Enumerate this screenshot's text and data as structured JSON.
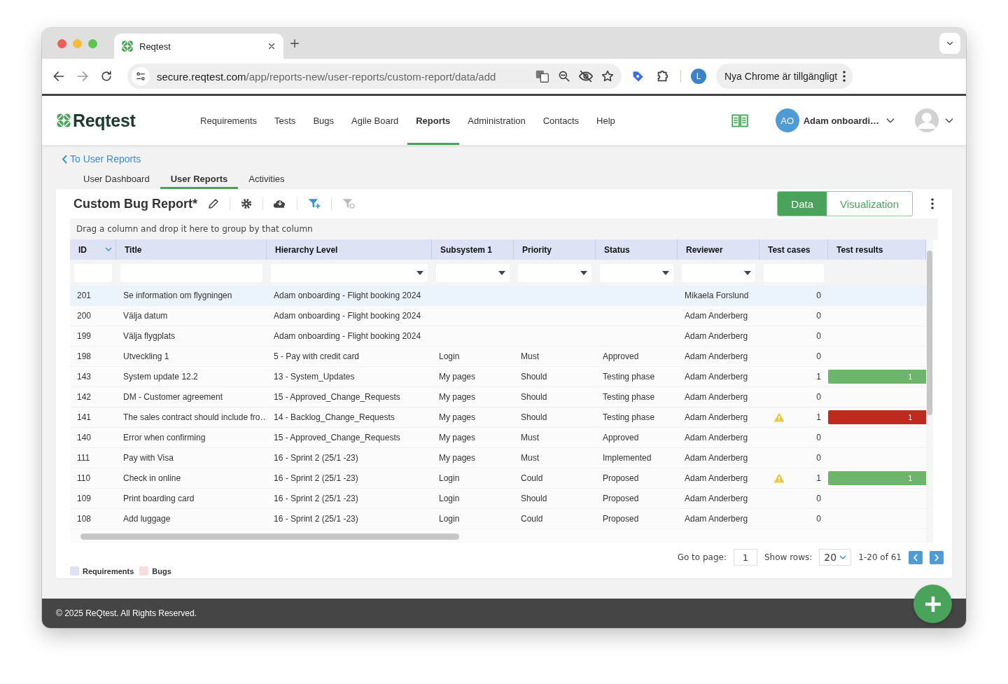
{
  "browser": {
    "tab_title": "Reqtest",
    "url_host": "secure.reqtest.com",
    "url_path": "/app/reports-new/user-reports/custom-report/data/add",
    "profile": "L",
    "update_button": "Nya Chrome är tillgängligt"
  },
  "header": {
    "logo": "Reqtest",
    "nav": [
      {
        "label": "Requirements",
        "selected": false
      },
      {
        "label": "Tests",
        "selected": false
      },
      {
        "label": "Bugs",
        "selected": false
      },
      {
        "label": "Agile Board",
        "selected": false
      },
      {
        "label": "Reports",
        "selected": true
      },
      {
        "label": "Administration",
        "selected": false
      },
      {
        "label": "Contacts",
        "selected": false
      },
      {
        "label": "Help",
        "selected": false
      }
    ],
    "user_initials": "AO",
    "user_name": "Adam onboardi…"
  },
  "back_link": "To User Reports",
  "subtabs": [
    {
      "label": "User Dashboard",
      "selected": false
    },
    {
      "label": "User Reports",
      "selected": true
    },
    {
      "label": "Activities",
      "selected": false
    }
  ],
  "report": {
    "title": "Custom Bug Report*",
    "views": [
      {
        "label": "Data",
        "selected": true
      },
      {
        "label": "Visualization",
        "selected": false
      }
    ],
    "group_hint": "Drag a column and drop it here to group by that column"
  },
  "table": {
    "columns": [
      {
        "label": "ID",
        "kind": "text",
        "sortable": true
      },
      {
        "label": "Title",
        "kind": "text",
        "sortable": false
      },
      {
        "label": "Hierarchy Level",
        "kind": "select",
        "sortable": false
      },
      {
        "label": "Subsystem 1",
        "kind": "select",
        "sortable": false
      },
      {
        "label": "Priority",
        "kind": "select",
        "sortable": false
      },
      {
        "label": "Status",
        "kind": "select",
        "sortable": false
      },
      {
        "label": "Reviewer",
        "kind": "select",
        "sortable": false
      },
      {
        "label": "Test cases",
        "kind": "text",
        "sortable": false
      },
      {
        "label": "Test results",
        "kind": "none",
        "sortable": false
      }
    ],
    "rows": [
      {
        "selected": true,
        "cells": [
          "201",
          "Se information om flygningen",
          "Adam onboarding - Flight booking 2024",
          "",
          "",
          "",
          "Mikaela Forslund",
          "0"
        ],
        "warning": false
      },
      {
        "selected": false,
        "cells": [
          "200",
          "Välja datum",
          "Adam onboarding - Flight booking 2024",
          "",
          "",
          "",
          "Adam Anderberg",
          "0"
        ],
        "warning": false
      },
      {
        "selected": false,
        "cells": [
          "199",
          "Välja flygplats",
          "Adam onboarding - Flight booking 2024",
          "",
          "",
          "",
          "Adam Anderberg",
          "0"
        ],
        "warning": false
      },
      {
        "selected": false,
        "cells": [
          "198",
          "Utveckling 1",
          "5 - Pay with credit card",
          "Login",
          "Must",
          "Approved",
          "Adam Anderberg",
          "0"
        ],
        "warning": false
      },
      {
        "selected": false,
        "cells": [
          "143",
          "System update 12.2",
          "13 - System_Updates",
          "My pages",
          "Should",
          "Testing phase",
          "Adam Anderberg",
          "1"
        ],
        "warning": false,
        "result": {
          "label": "1",
          "color": "#6db56d"
        }
      },
      {
        "selected": false,
        "cells": [
          "142",
          "DM - Customer agreement",
          "15 - Approved_Change_Requests",
          "My pages",
          "Should",
          "Testing phase",
          "Adam Anderberg",
          "0"
        ],
        "warning": false
      },
      {
        "selected": false,
        "cells": [
          "141",
          "The sales contract should include fro…",
          "14 - Backlog_Change_Requests",
          "My pages",
          "Should",
          "Testing phase",
          "Adam Anderberg",
          "1"
        ],
        "warning": true,
        "result": {
          "label": "1",
          "color": "#bf2a1f"
        }
      },
      {
        "selected": false,
        "cells": [
          "140",
          "Error when confirming",
          "15 - Approved_Change_Requests",
          "My pages",
          "Must",
          "Approved",
          "Adam Anderberg",
          "0"
        ],
        "warning": false
      },
      {
        "selected": false,
        "cells": [
          "111",
          "Pay with Visa",
          "16 - Sprint 2 (25/1 -23)",
          "My pages",
          "Must",
          "Implemented",
          "Adam Anderberg",
          "0"
        ],
        "warning": false
      },
      {
        "selected": false,
        "cells": [
          "110",
          "Check in online",
          "16 - Sprint 2 (25/1 -23)",
          "Login",
          "Could",
          "Proposed",
          "Adam Anderberg",
          "1"
        ],
        "warning": true,
        "result": {
          "label": "1",
          "color": "#6db56d"
        }
      },
      {
        "selected": false,
        "cells": [
          "109",
          "Print boarding card",
          "16 - Sprint 2 (25/1 -23)",
          "Login",
          "Should",
          "Proposed",
          "Adam Anderberg",
          "0"
        ],
        "warning": false
      },
      {
        "selected": false,
        "cells": [
          "108",
          "Add luggage",
          "16 - Sprint 2 (25/1 -23)",
          "Login",
          "Could",
          "Proposed",
          "Adam Anderberg",
          "0"
        ],
        "warning": false
      }
    ]
  },
  "pager": {
    "go_to_label": "Go to page:",
    "page": "1",
    "rows_label": "Show rows:",
    "rows": "20",
    "range": "1-20 of 61"
  },
  "legend": [
    {
      "label": "Requirements",
      "color": "#dde3f5"
    },
    {
      "label": "Bugs",
      "color": "#f7dede"
    }
  ],
  "footer": "© 2025 ReQtest. All Rights Reserved."
}
